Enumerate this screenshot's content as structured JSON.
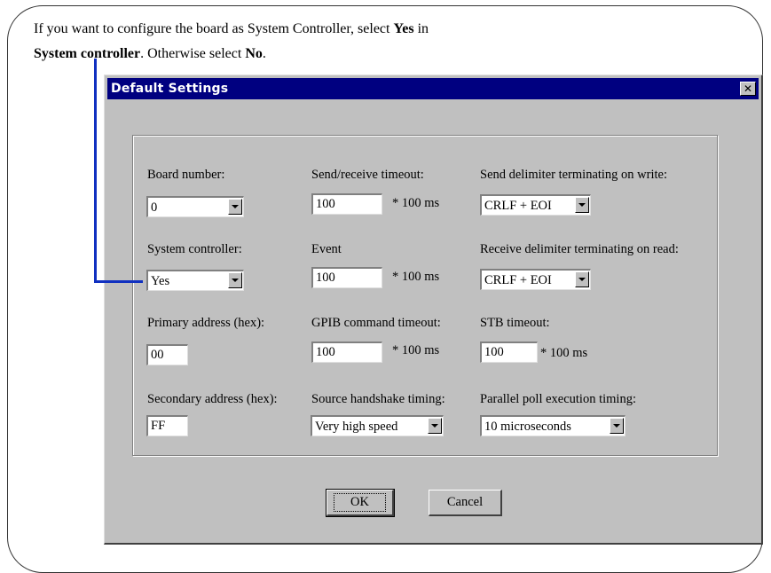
{
  "instruction": {
    "prefix": "If you want to configure the board as System Controller, select ",
    "yes_bold": "Yes",
    "mid": " in",
    "field_bold": "System controller",
    "mid2": ". Otherwise select ",
    "no_bold": "No",
    "suffix": "."
  },
  "dialog": {
    "title": "Default Settings",
    "close_glyph": "✕"
  },
  "col1": {
    "board_number_label": "Board number:",
    "board_number_value": "0",
    "system_controller_label": "System controller:",
    "system_controller_value": "Yes",
    "primary_address_label": "Primary address (hex):",
    "primary_address_value": "00",
    "secondary_address_label": "Secondary address (hex):",
    "secondary_address_value": "FF"
  },
  "col2": {
    "send_receive_timeout_label": "Send/receive timeout:",
    "send_receive_timeout_value": "100",
    "event_label": "Event",
    "event_value": "100",
    "gpib_timeout_label": "GPIB command timeout:",
    "gpib_timeout_value": "100",
    "source_handshake_label": "Source handshake timing:",
    "source_handshake_value": "Very high speed",
    "unit": "* 100 ms"
  },
  "col3": {
    "send_delimiter_label": "Send delimiter terminating on write:",
    "send_delimiter_value": "CRLF + EOI",
    "receive_delimiter_label": "Receive delimiter terminating on read:",
    "receive_delimiter_value": "CRLF + EOI",
    "stb_timeout_label": "STB timeout:",
    "stb_timeout_value": "100",
    "parallel_poll_label": "Parallel poll execution timing:",
    "parallel_poll_value": "10 microseconds"
  },
  "buttons": {
    "ok": "OK",
    "cancel": "Cancel"
  },
  "colors": {
    "callout": "#1030c0",
    "titlebar": "#000080",
    "dialog_bg": "#c0c0c0"
  }
}
